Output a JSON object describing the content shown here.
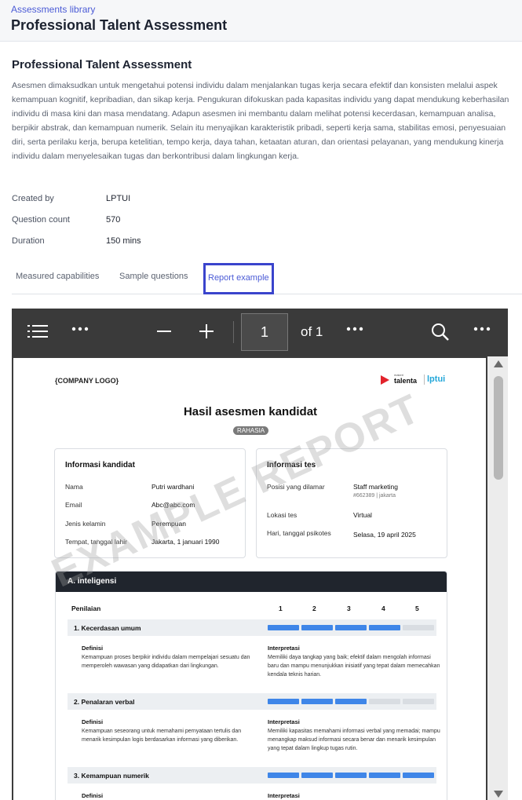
{
  "header": {
    "breadcrumb": "Assessments library",
    "title": "Professional Talent Assessment"
  },
  "main": {
    "title": "Professional Talent Assessment",
    "description": "Asesmen dimaksudkan untuk mengetahui potensi individu dalam menjalankan tugas kerja secara efektif dan konsisten melalui aspek kemampuan kognitif, kepribadian, dan sikap kerja. Pengukuran difokuskan pada kapasitas individu yang dapat mendukung keberhasilan individu di masa kini dan masa mendatang. Adapun asesmen ini membantu dalam melihat potensi kecerdasan, kemampuan analisa, berpikir abstrak, dan kemampuan numerik. Selain itu menyajikan karakteristik pribadi, seperti kerja sama, stabilitas emosi, penyesuaian diri, serta perilaku kerja, berupa ketelitian, tempo kerja, daya tahan, ketaatan aturan, dan orientasi pelayanan, yang mendukung kinerja individu dalam menyelesaikan tugas dan berkontribusi dalam lingkungan kerja.",
    "meta": [
      {
        "label": "Created by",
        "value": "LPTUI"
      },
      {
        "label": "Question count",
        "value": "570"
      },
      {
        "label": "Duration",
        "value": "150 mins"
      }
    ],
    "tabs": [
      {
        "label": "Measured capabilities"
      },
      {
        "label": "Sample questions"
      },
      {
        "label": "Report example",
        "active": true
      }
    ]
  },
  "viewer": {
    "current_page": "1",
    "of_label": "of 1"
  },
  "report": {
    "company_logo": "{COMPANY LOGO}",
    "brand": {
      "small": "makeri",
      "name": "talenta",
      "partner": "lptui"
    },
    "title": "Hasil asesmen kandidat",
    "badge": "RAHASIA",
    "watermark": "EXAMPLE REPORT",
    "candidate": {
      "title": "Informasi kandidat",
      "rows": [
        {
          "label": "Nama",
          "value": "Putri wardhani"
        },
        {
          "label": "Email",
          "value": "Abc@abc.com"
        },
        {
          "label": "Jenis kelamin",
          "value": "Perempuan"
        },
        {
          "label": "Tempat, tanggal lahir",
          "value": "Jakarta, 1 januari 1990"
        }
      ]
    },
    "test": {
      "title": "Informasi tes",
      "rows": [
        {
          "label": "Posisi yang dilamar",
          "value": "Staff marketing",
          "sub": "#662389 | jakarta"
        },
        {
          "label": "Lokasi tes",
          "value": "Virtual"
        },
        {
          "label": "Hari, tanggal psikotes",
          "value": "Selasa, 19 april 2025"
        }
      ]
    },
    "section": {
      "title": "A. inteligensi",
      "score_label": "Penilaian",
      "scale": [
        "1",
        "2",
        "3",
        "4",
        "5"
      ],
      "capabilities": [
        {
          "name": "1. Kecerdasan umum",
          "score": 4,
          "def_label": "Definisi",
          "definition": "Kemampuan proses berpikir individu dalam mempelajari sesuatu dan memperoleh wawasan yang didapatkan dari lingkungan.",
          "int_label": "Interpretasi",
          "interpretation": "Memiliki daya tangkap yang baik; efektif dalam mengolah informasi baru dan mampu menunjukkan inisiatif yang tepat dalam memecahkan kendala teknis harian."
        },
        {
          "name": "2. Penalaran verbal",
          "score": 3,
          "def_label": "Definisi",
          "definition": "Kemampuan seseorang untuk memahami pernyataan tertulis dan menarik kesimpulan logis berdasarkan informasi yang diberikan.",
          "int_label": "Interpretasi",
          "interpretation": "Memiliki kapasitas memahami informasi verbal yang memadai; mampu menangkap maksud informasi secara benar dan menarik kesimpulan yang tepat dalam lingkup tugas rutin."
        },
        {
          "name": "3. Kemampuan numerik",
          "score": 5,
          "def_label": "Definisi",
          "definition": "",
          "int_label": "Interpretasi",
          "interpretation": ""
        }
      ]
    }
  }
}
